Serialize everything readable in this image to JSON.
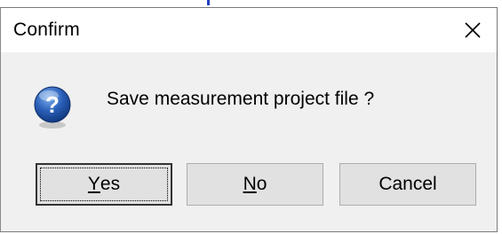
{
  "dialog": {
    "title": "Confirm",
    "message": "Save measurement project file ?",
    "icon": "question-icon",
    "buttons": {
      "yes": {
        "access_key": "Y",
        "rest": "es"
      },
      "no": {
        "access_key": "N",
        "rest": "o"
      },
      "cancel": {
        "label": "Cancel"
      }
    }
  },
  "colors": {
    "titlebar_bg": "#ffffff",
    "body_bg": "#f0f0f0",
    "button_bg": "#e1e1e1",
    "icon_blue": "#2a5fb8"
  }
}
